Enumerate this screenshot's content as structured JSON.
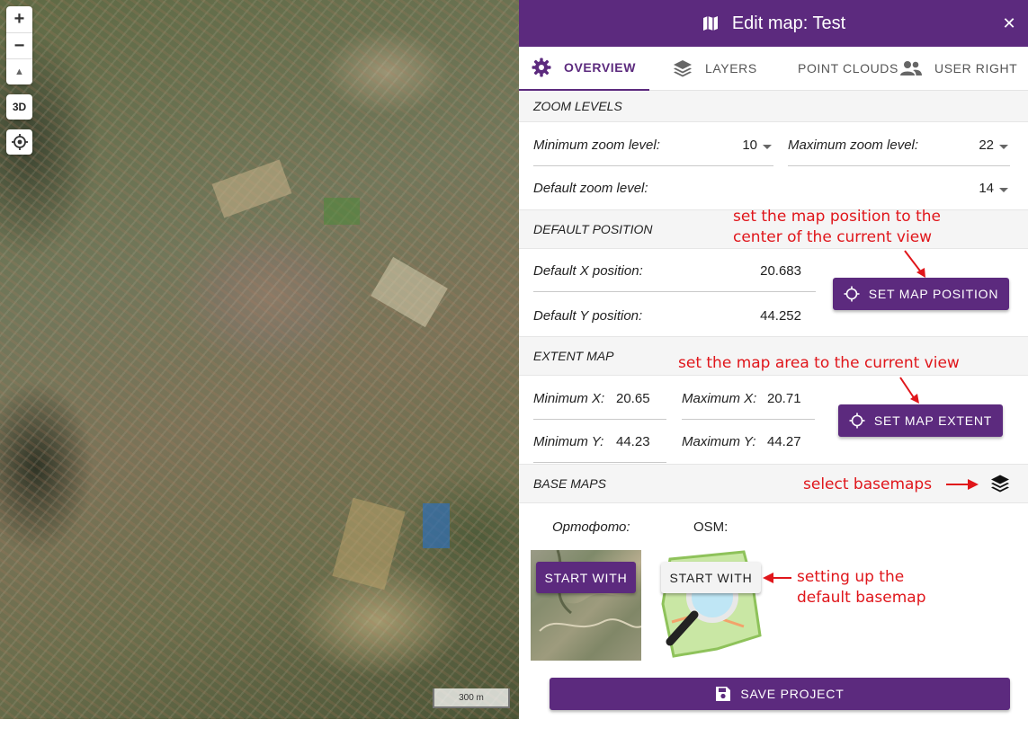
{
  "map": {
    "zoom_in": "+",
    "zoom_out": "−",
    "compass": "▲",
    "mode_3d": "3D",
    "scale_label": "300 m"
  },
  "panel": {
    "title": "Edit map: Test",
    "close": "✕",
    "tabs": [
      {
        "label": "OVERVIEW",
        "icon": "gear-icon",
        "active": true
      },
      {
        "label": "LAYERS",
        "icon": "layers-icon",
        "active": false
      },
      {
        "label": "POINT CLOUDS",
        "icon": "line-chart-icon",
        "active": false
      },
      {
        "label": "USER RIGHT",
        "icon": "users-icon",
        "active": false
      }
    ]
  },
  "zoom_levels": {
    "heading": "ZOOM LEVELS",
    "min_label": "Minimum zoom level:",
    "min_value": "10",
    "max_label": "Maximum zoom level:",
    "max_value": "22",
    "default_label": "Default zoom level:",
    "default_value": "14"
  },
  "default_position": {
    "heading": "DEFAULT POSITION",
    "x_label": "Default X position:",
    "x_value": "20.683",
    "y_label": "Default Y position:",
    "y_value": "44.252",
    "button": "SET MAP POSITION"
  },
  "extent_map": {
    "heading": "EXTENT MAP",
    "min_x_label": "Minimum X:",
    "min_x_value": "20.65",
    "max_x_label": "Maximum X:",
    "max_x_value": "20.71",
    "min_y_label": "Minimum Y:",
    "min_y_value": "44.23",
    "max_y_label": "Maximum Y:",
    "max_y_value": "44.27",
    "button": "SET MAP EXTENT"
  },
  "base_maps": {
    "heading": "BASE MAPS",
    "items": [
      {
        "name": "Ортофото:",
        "button": "START WITH",
        "selected": true
      },
      {
        "name": "OSM:",
        "button": "START WITH",
        "selected": false
      }
    ]
  },
  "annotations": {
    "position_note_line1": "set the map position to the",
    "position_note_line2": "center of the current view",
    "extent_note": "set the map area to the current view",
    "basemaps_note": "select basemaps",
    "default_basemap_line1": "setting up the",
    "default_basemap_line2": "default basemap"
  },
  "footer": {
    "save_button": "SAVE PROJECT"
  },
  "colors": {
    "brand_purple": "#5c2a7e",
    "annotation_red": "#e0161b"
  }
}
